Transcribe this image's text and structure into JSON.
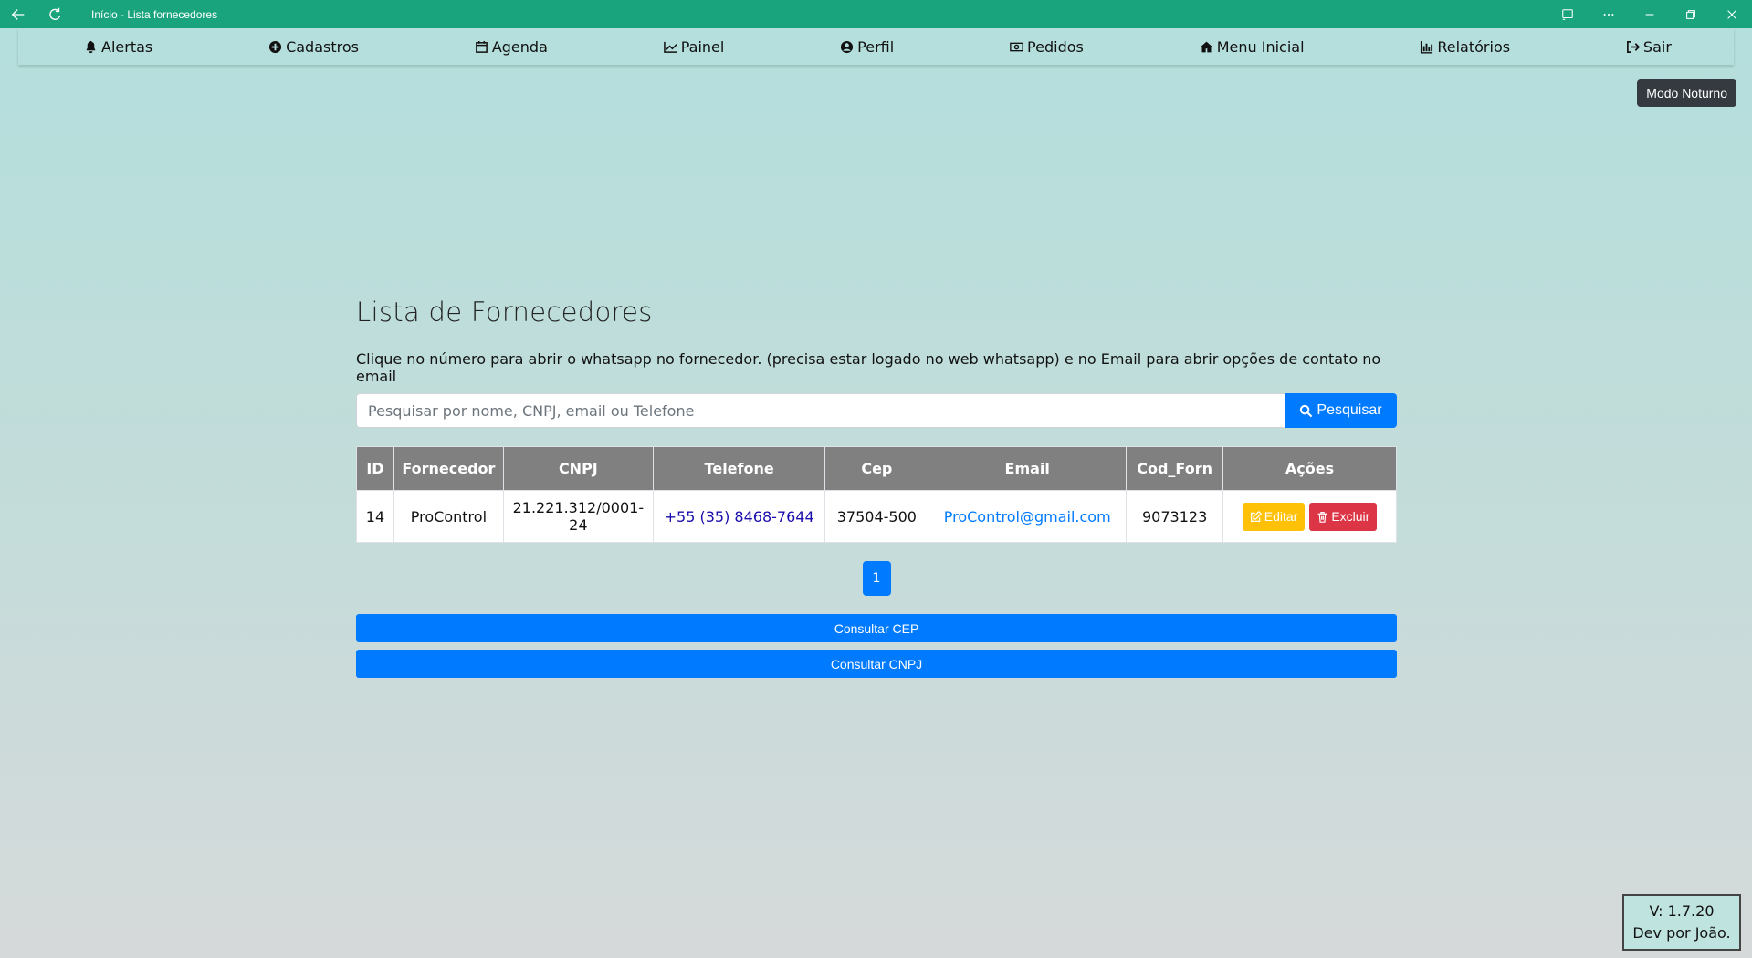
{
  "window": {
    "title": "Início - Lista fornecedores"
  },
  "nav": {
    "items": [
      {
        "label": "Alertas",
        "icon": "bell-icon"
      },
      {
        "label": "Cadastros",
        "icon": "plus-circle-icon"
      },
      {
        "label": "Agenda",
        "icon": "calendar-icon"
      },
      {
        "label": "Painel",
        "icon": "line-chart-icon"
      },
      {
        "label": "Perfil",
        "icon": "user-circle-icon"
      },
      {
        "label": "Pedidos",
        "icon": "money-bill-icon"
      },
      {
        "label": "Menu Inicial",
        "icon": "home-icon"
      },
      {
        "label": "Relatórios",
        "icon": "bar-chart-icon"
      },
      {
        "label": "Sair",
        "icon": "sign-out-icon"
      }
    ]
  },
  "night_mode_label": "Modo Noturno",
  "page": {
    "title": "Lista de Fornecedores",
    "hint": "Clique no número para abrir o whatsapp no fornecedor. (precisa estar logado no web whatsapp) e no Email para abrir opções de contato no email"
  },
  "search": {
    "placeholder": "Pesquisar por nome, CNPJ, email ou Telefone",
    "value": "",
    "button_label": "Pesquisar"
  },
  "table": {
    "headers": [
      "ID",
      "Fornecedor",
      "CNPJ",
      "Telefone",
      "Cep",
      "Email",
      "Cod_Forn",
      "Ações"
    ],
    "rows": [
      {
        "id": "14",
        "fornecedor": "ProControl",
        "cnpj": "21.221.312/0001-24",
        "telefone": "+55 (35) 8468-7644",
        "cep": "37504-500",
        "email": "ProControl@gmail.com",
        "cod_forn": "9073123",
        "edit_label": "Editar",
        "delete_label": "Excluir"
      }
    ]
  },
  "pagination": {
    "current_page": "1"
  },
  "buttons": {
    "consultar_cep": "Consultar CEP",
    "consultar_cnpj": "Consultar CNPJ"
  },
  "footer": {
    "version": "V: 1.7.20",
    "dev": "Dev por João."
  },
  "colors": {
    "titlebar": "#1aa47e",
    "primary": "#007bff",
    "warning": "#ffc107",
    "danger": "#dc3545",
    "table_header": "#808080"
  }
}
